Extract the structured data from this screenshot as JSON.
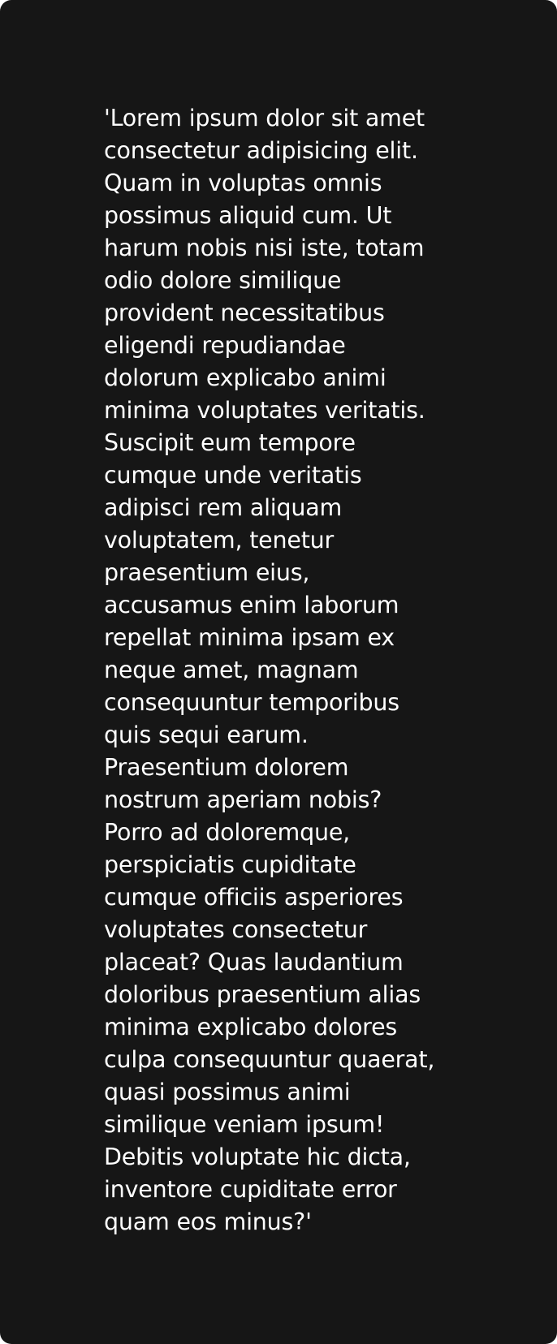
{
  "card": {
    "text": "'Lorem ipsum dolor sit amet\nconsectetur adipisicing elit.\nQuam in voluptas omnis\npossimus aliquid cum. Ut\nharum nobis nisi iste, totam\nodio dolore similique\nprovident necessitatibus\neligendi repudiandae\ndolorum explicabo animi\nminima voluptates veritatis.\nSuscipit eum tempore\ncumque unde veritatis\nadipisci rem aliquam\nvoluptatem, tenetur\npraesentium eius,\naccusamus enim laborum\nrepellat minima ipsam ex\nneque amet, magnam\nconsequuntur temporibus\nquis sequi earum.\nPraesentium dolorem\nnostrum aperiam nobis?\nPorro ad doloremque,\nperspiciatis cupiditate\ncumque officiis asperiores\nvoluptates consectetur\nplaceat? Quas laudantium\ndoloribus praesentium alias\nminima explicabo dolores\nculpa consequuntur quaerat,\nquasi possimus animi\nsimilique veniam ipsum!\nDebitis voluptate hic dicta,\ninventore cupiditate error\nquam eos minus?'"
  },
  "colors": {
    "background": "#161616",
    "text": "#ffffff"
  }
}
